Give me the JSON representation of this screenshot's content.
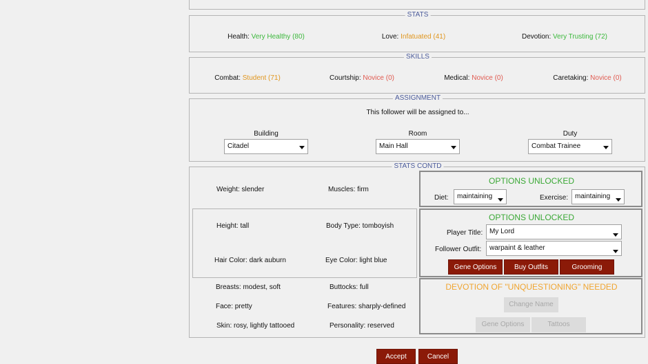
{
  "stats": {
    "legend": "STATS",
    "items": [
      {
        "label": "Health:",
        "value": "Very Healthy (80)",
        "color": "#3cb83c"
      },
      {
        "label": "Love:",
        "value": "Infatuated (41)",
        "color": "#e0961e"
      },
      {
        "label": "Devotion:",
        "value": "Very Trusting (72)",
        "color": "#3cb83c"
      }
    ]
  },
  "skills": {
    "legend": "SKILLS",
    "items": [
      {
        "label": "Combat:",
        "value": "Student (71)",
        "color": "#e0961e"
      },
      {
        "label": "Courtship:",
        "value": "Novice (0)",
        "color": "#e05a50"
      },
      {
        "label": "Medical:",
        "value": "Novice (0)",
        "color": "#e05a50"
      },
      {
        "label": "Caretaking:",
        "value": "Novice (0)",
        "color": "#e05a50"
      }
    ]
  },
  "assignment": {
    "legend": "ASSIGNMENT",
    "subtitle": "This follower will be assigned to...",
    "building_label": "Building",
    "building_value": "Citadel",
    "room_label": "Room",
    "room_value": "Main Hall",
    "duty_label": "Duty",
    "duty_value": "Combat Trainee"
  },
  "stats_contd": {
    "legend": "STATS CONTD",
    "weight": "Weight: slender",
    "muscles": "Muscles: firm",
    "height": "Height:  tall",
    "body_type": "Body Type:  tomboyish",
    "hair_color": "Hair Color: dark auburn",
    "eye_color": "Eye Color: light blue",
    "breasts": "Breasts:  modest, soft",
    "buttocks": "Buttocks:  full",
    "face": "Face: pretty",
    "features": "Features: sharply-defined",
    "skin": "Skin: rosy, lightly tattooed",
    "personality": "Personality: reserved"
  },
  "options1": {
    "title": "OPTIONS UNLOCKED",
    "diet_label": "Diet:",
    "diet_value": "maintaining",
    "exercise_label": "Exercise:",
    "exercise_value": "maintaining"
  },
  "options2": {
    "title": "OPTIONS UNLOCKED",
    "player_title_label": "Player Title:",
    "player_title_value": "My Lord",
    "outfit_label": "Follower Outfit:",
    "outfit_value": "warpaint & leather",
    "gene_options": "Gene Options",
    "buy_outfits": "Buy Outfits",
    "grooming": "Grooming"
  },
  "devotion_lock": {
    "title": "DEVOTION OF \"UNQUESTIONING\" NEEDED",
    "change_name": "Change Name",
    "gene_options": "Gene Options",
    "tattoos": "Tattoos"
  },
  "footer": {
    "accept": "Accept",
    "cancel": "Cancel"
  }
}
